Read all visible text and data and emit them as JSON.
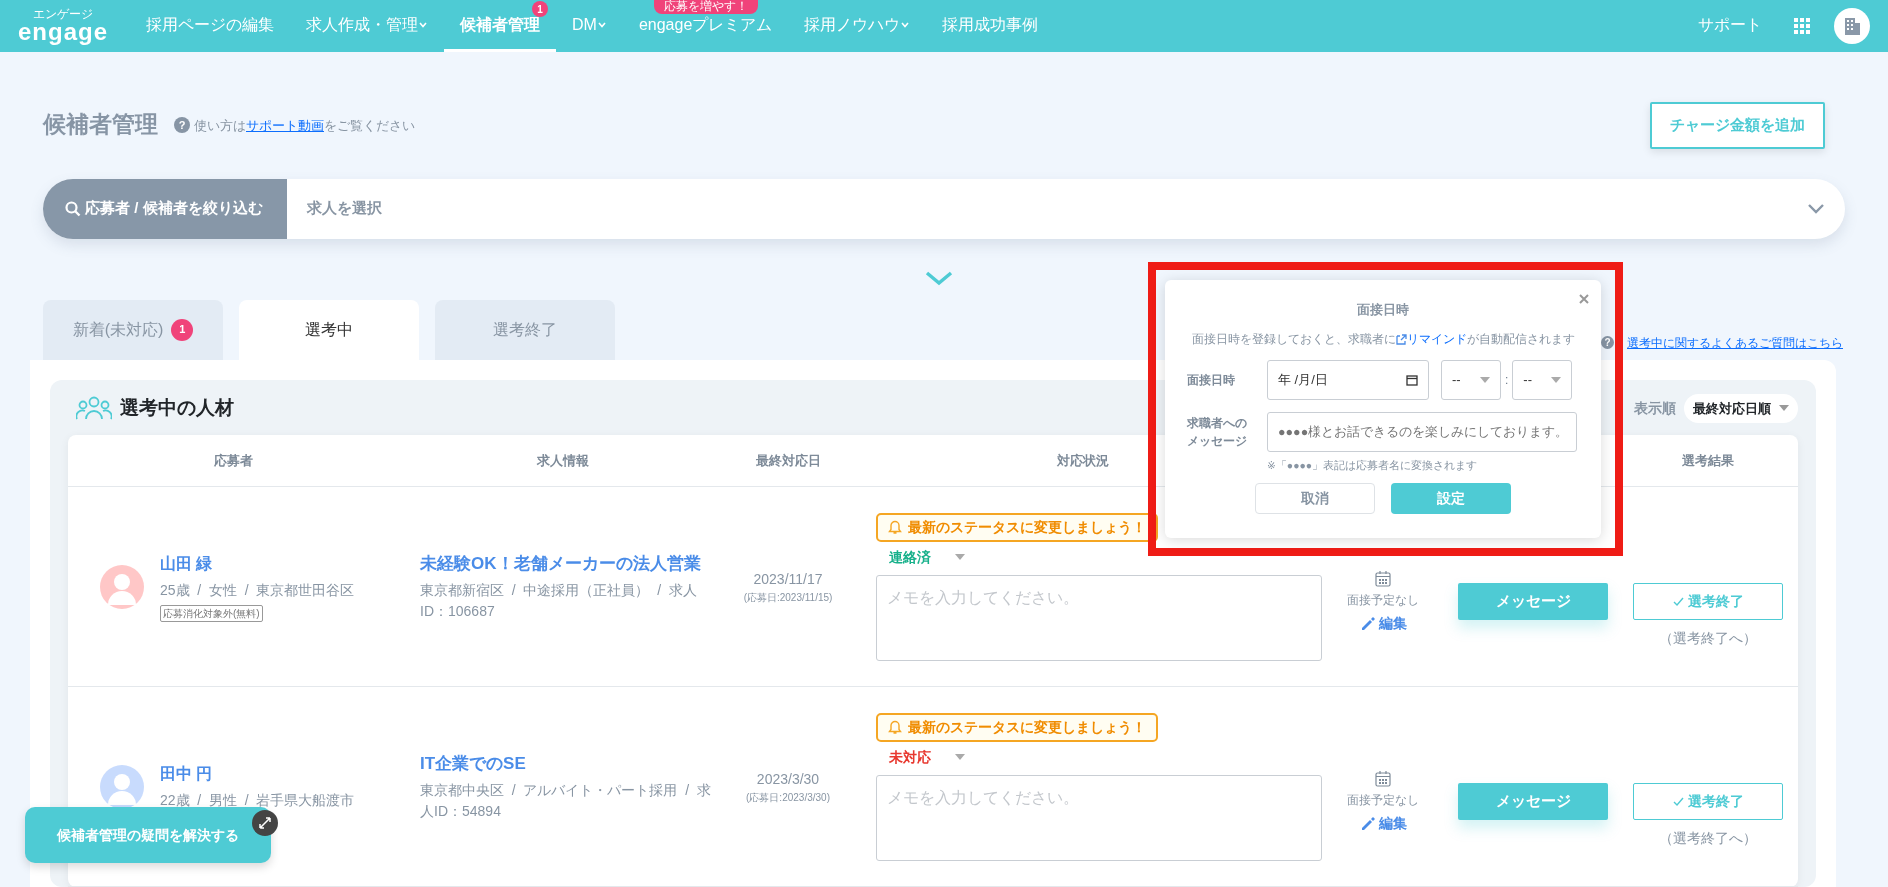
{
  "navbar": {
    "logo": {
      "ruby": "エンゲージ",
      "text": "engage"
    },
    "items": [
      {
        "label": "採用ページの編集",
        "dropdown": false,
        "selected": false
      },
      {
        "label": "求人作成・管理",
        "dropdown": true,
        "selected": false
      },
      {
        "label": "候補者管理",
        "dropdown": false,
        "selected": true,
        "badge": "1"
      },
      {
        "label": "DM",
        "dropdown": true,
        "selected": false
      },
      {
        "label": "engageプレミアム",
        "dropdown": false,
        "selected": false,
        "ribbon": "応募を増やす！"
      },
      {
        "label": "採用ノウハウ",
        "dropdown": true,
        "selected": false
      },
      {
        "label": "採用成功事例",
        "dropdown": false,
        "selected": false
      }
    ],
    "support": "サポート"
  },
  "page": {
    "title": "候補者管理",
    "help_icon": "?",
    "help": {
      "before": "使い方は",
      "link": "サポート動画",
      "after": "をご覧ください"
    },
    "charge_button": "チャージ金額を追加"
  },
  "filter": {
    "button": "応募者 / 候補者を絞り込む",
    "placeholder": "求人を選択"
  },
  "tabs": [
    {
      "label": "新着(未対応)",
      "badge": "1",
      "selected": false
    },
    {
      "label": "選考中",
      "selected": true
    },
    {
      "label": "選考終了",
      "selected": false
    }
  ],
  "faq": {
    "icon": "?",
    "link": "選考中に関するよくあるご質問はこちら"
  },
  "panel": {
    "title": "選考中の人材",
    "sort_label": "表示順",
    "sort_value": "最終対応日順"
  },
  "table": {
    "columns": [
      "応募者",
      "求人情報",
      "最終対応日",
      "対応状況",
      "選考結果"
    ],
    "rows": [
      {
        "name": "山田 緑",
        "details": "25歳  /  女性  /  東京都世田谷区",
        "tag": "応募消化対象外(無料)",
        "color": "#ffc7c7",
        "job_title": "未経験OK！老舗メーカーの法人営業",
        "job_details": "東京都新宿区  /  中途採用（正社員）  /  求人ID：106687",
        "date": "2023/11/17",
        "applied": "(応募日:2023/11/15)",
        "notice": "最新のステータスに変更しましょう！",
        "status": {
          "label": "連絡済",
          "color": "#16b08a"
        },
        "memo_placeholder": "メモを入力してください。",
        "interview": "面接予定なし",
        "edit": "編集",
        "message_button": "メッセージ",
        "result_button": "選考終了",
        "result_note": "（選考終了へ）"
      },
      {
        "name": "田中 円",
        "details": "22歳  /  男性  /  岩手県大船渡市",
        "color": "#c8dbfd",
        "job_title": "IT企業でのSE",
        "job_details": "東京都中央区  /  アルバイト・パート採用  /  求人ID：54894",
        "date": "2023/3/30",
        "applied": "(応募日:2023/3/30)",
        "notice": "最新のステータスに変更しましょう！",
        "status": {
          "label": "未対応",
          "color": "#e8382f"
        },
        "memo_placeholder": "メモを入力してください。",
        "interview": "面接予定なし",
        "edit": "編集",
        "message_button": "メッセージ",
        "result_button": "選考終了",
        "result_note": "（選考終了へ）"
      }
    ]
  },
  "popup": {
    "title": "面接日時",
    "description": {
      "before": "面接日時を登録しておくと、求職者に",
      "link": "リマインド",
      "after": "が自動配信されます"
    },
    "date_label": "面接日時",
    "date_placeholder": "年 /月/日",
    "hour": "--",
    "separator": ":",
    "minute": "--",
    "message_label": [
      "求職者への",
      "メッセージ"
    ],
    "message_placeholder": "●●●●様とお話できるのを楽しみにしております。",
    "note": "※「●●●●」表記は応募者名に変換されます",
    "cancel": "取消",
    "submit": "設定"
  },
  "help_widget": {
    "label": "候補者管理の疑問を解決する"
  }
}
